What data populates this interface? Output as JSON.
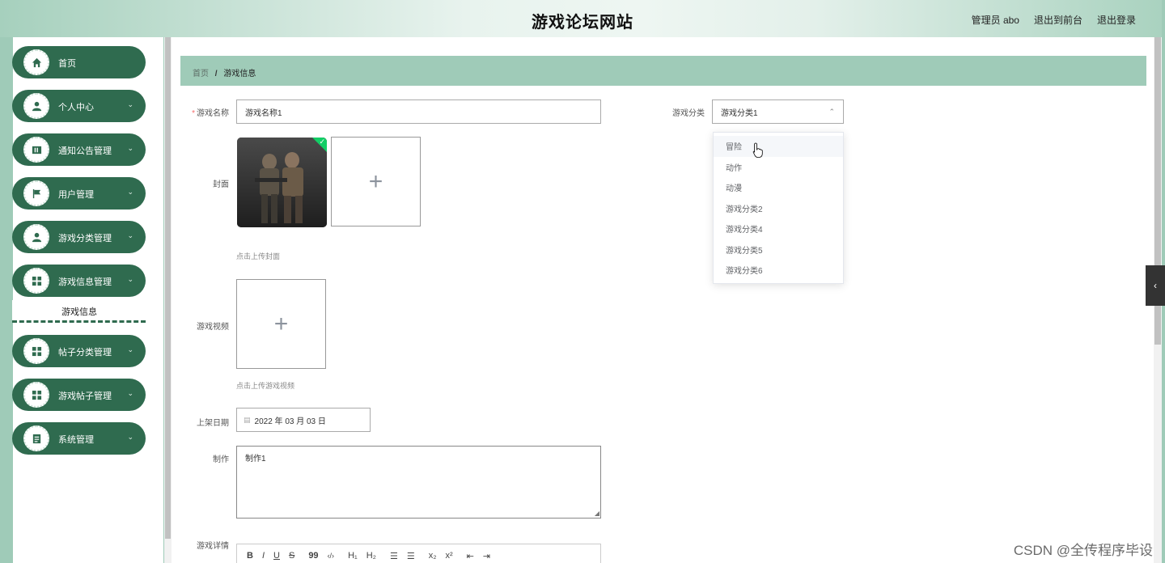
{
  "header": {
    "title": "游戏论坛网站",
    "user": "管理员 abo",
    "front_link": "退出到前台",
    "logout_link": "退出登录"
  },
  "sidebar": {
    "items": [
      {
        "label": "首页",
        "icon": "home-icon",
        "arrow": ""
      },
      {
        "label": "个人中心",
        "icon": "person-icon",
        "arrow": "⌄"
      },
      {
        "label": "通知公告管理",
        "icon": "book-icon",
        "arrow": "⌄"
      },
      {
        "label": "用户管理",
        "icon": "flag-icon",
        "arrow": "⌄"
      },
      {
        "label": "游戏分类管理",
        "icon": "person-icon",
        "arrow": "⌄"
      },
      {
        "label": "游戏信息管理",
        "icon": "grid-icon",
        "arrow": "⌄"
      },
      {
        "label": "帖子分类管理",
        "icon": "grid-icon",
        "arrow": "⌄"
      },
      {
        "label": "游戏帖子管理",
        "icon": "grid-icon",
        "arrow": "⌄"
      },
      {
        "label": "系统管理",
        "icon": "document-icon",
        "arrow": "⌄"
      }
    ],
    "submenu_label": "游戏信息"
  },
  "breadcrumb": {
    "home": "首页",
    "separator": "/",
    "current": "游戏信息"
  },
  "form": {
    "name_label": "游戏名称",
    "name_value": "游戏名称1",
    "category_label": "游戏分类",
    "category_value": "游戏分类1",
    "cover_label": "封面",
    "cover_hint": "点击上传封面",
    "video_label": "游戏视频",
    "video_hint": "点击上传游戏视频",
    "date_label": "上架日期",
    "date_value": "2022 年 03 月 03 日",
    "producer_label": "制作",
    "producer_value": "制作1",
    "detail_label": "游戏详情"
  },
  "dropdown_options": [
    "冒险",
    "动作",
    "动漫",
    "游戏分类2",
    "游戏分类4",
    "游戏分类5",
    "游戏分类6"
  ],
  "editor_toolbar": [
    "B",
    "I",
    "U",
    "S",
    "99",
    "‹/›",
    "H₁",
    "H₂",
    "☰",
    "☰",
    "x₂",
    "x²",
    "⇤",
    "⇥"
  ],
  "watermark": "CSDN @全传程序毕设",
  "colors": {
    "sidebar_item": "#2f6b4f",
    "background": "#9fcbb8",
    "success": "#13ce66"
  }
}
